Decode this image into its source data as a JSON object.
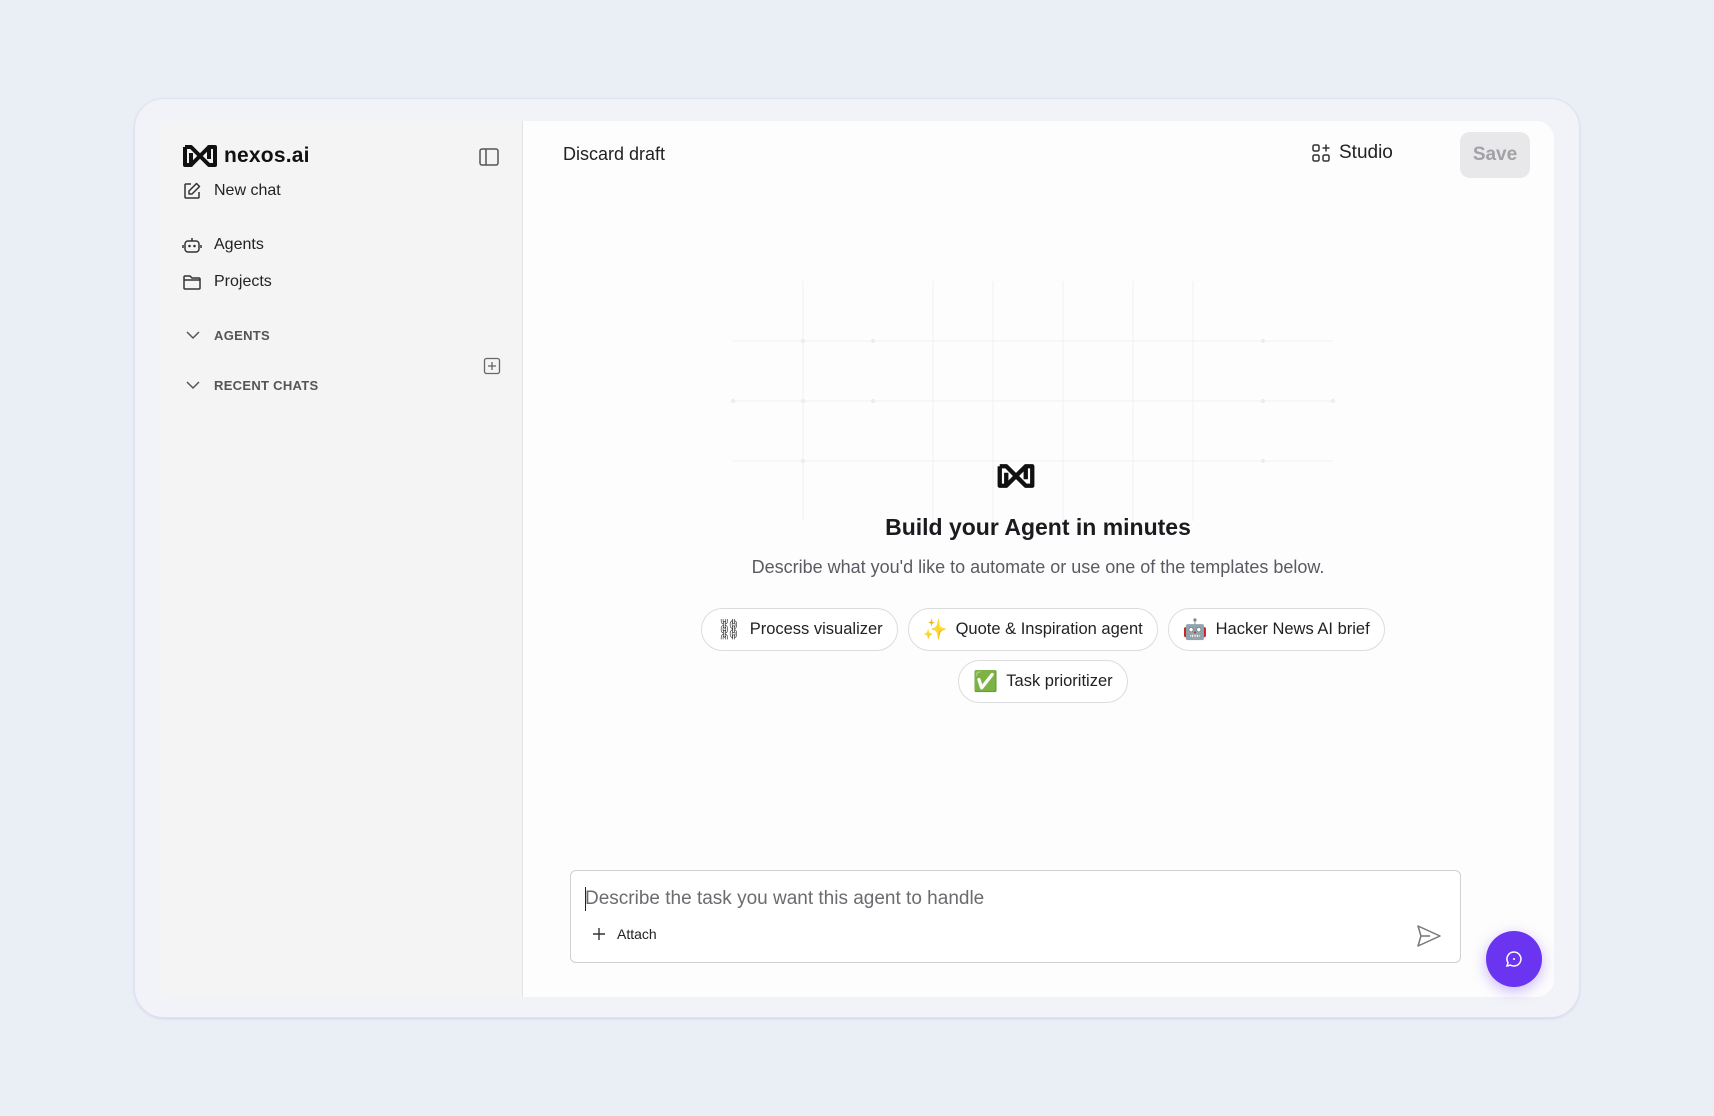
{
  "brand": {
    "name": "nexos.ai",
    "logo_icon": "nexos-logo-icon"
  },
  "sidebar": {
    "nav": [
      {
        "label": "New chat",
        "icon": "edit-icon"
      },
      {
        "label": "Agents",
        "icon": "robot-icon"
      },
      {
        "label": "Projects",
        "icon": "folder-icon"
      }
    ],
    "sections": [
      {
        "label": "AGENTS"
      },
      {
        "label": "RECENT CHATS"
      }
    ]
  },
  "header": {
    "discard_label": "Discard draft",
    "studio_label": "Studio",
    "save_label": "Save"
  },
  "hero": {
    "title": "Build your Agent in minutes",
    "subtitle": "Describe what you'd like to automate or use one of the templates below."
  },
  "templates": [
    {
      "emoji": "⛓",
      "label": "Process visualizer"
    },
    {
      "emoji": "✨",
      "label": "Quote & Inspiration agent"
    },
    {
      "emoji": "🤖",
      "label": "Hacker News AI brief"
    },
    {
      "emoji": "✅",
      "label": "Task prioritizer"
    }
  ],
  "composer": {
    "placeholder": "Describe the task you want this agent to handle",
    "attach_label": "Attach"
  },
  "colors": {
    "accent": "#6a34f0",
    "background": "#eaeef5",
    "sidebar": "#f4f4f5"
  }
}
